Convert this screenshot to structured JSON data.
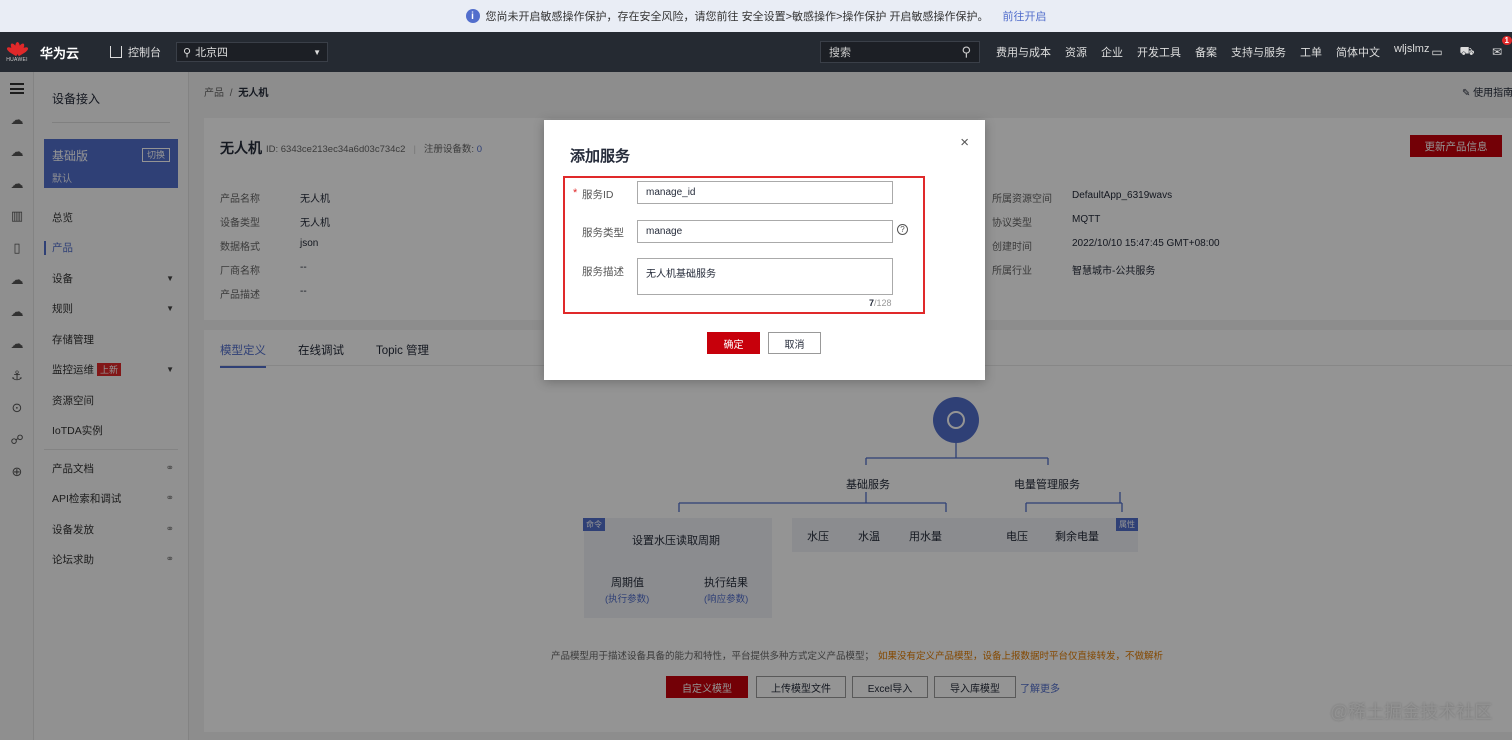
{
  "notice": {
    "text": "您尚未开启敏感操作保护，存在安全风险，请您前往 安全设置>敏感操作>操作保护 开启敏感操作保护。",
    "link": "前往开启"
  },
  "header": {
    "logo_caption": "HUAWEI",
    "brand": "华为云",
    "console": "控制台",
    "region": "北京四",
    "search_placeholder": "搜索",
    "nav": [
      "费用与成本",
      "资源",
      "企业",
      "开发工具",
      "备案",
      "支持与服务",
      "工单",
      "简体中文",
      "wljslmz"
    ],
    "badge": "1"
  },
  "sidebar": {
    "title": "设备接入",
    "edition": {
      "name": "基础版",
      "switch": "切换",
      "sub": "默认"
    },
    "items": [
      {
        "label": "总览"
      },
      {
        "label": "产品"
      },
      {
        "label": "设备"
      },
      {
        "label": "规则"
      },
      {
        "label": "存储管理"
      },
      {
        "label": "监控运维",
        "badge": "上新"
      },
      {
        "label": "资源空间"
      },
      {
        "label": "IoTDA实例"
      },
      {
        "label": "产品文档"
      },
      {
        "label": "API检索和调试"
      },
      {
        "label": "设备发放"
      },
      {
        "label": "论坛求助"
      }
    ]
  },
  "breadcrumb": {
    "parent": "产品",
    "sep": "/",
    "current": "无人机"
  },
  "guide": "使用指南",
  "product": {
    "name": "无人机",
    "id_label": "ID: 6343ce213ec34a6d03c734c2",
    "devices_label": "注册设备数:",
    "devices_count": "0",
    "update_button": "更新产品信息",
    "left": [
      {
        "k": "产品名称",
        "v": "无人机"
      },
      {
        "k": "设备类型",
        "v": "无人机"
      },
      {
        "k": "数据格式",
        "v": "json"
      },
      {
        "k": "厂商名称",
        "v": "--"
      },
      {
        "k": "产品描述",
        "v": "--"
      }
    ],
    "right": [
      {
        "k": "所属资源空间",
        "v": "DefaultApp_6319wavs"
      },
      {
        "k": "协议类型",
        "v": "MQTT"
      },
      {
        "k": "创建时间",
        "v": "2022/10/10 15:47:45 GMT+08:00"
      },
      {
        "k": "所属行业",
        "v": "智慧城市-公共服务"
      }
    ]
  },
  "tabs": [
    "模型定义",
    "在线调试",
    "Topic 管理"
  ],
  "diagram": {
    "service1": "基础服务",
    "service2": "电量管理服务",
    "command_tag": "命令",
    "property_tag": "属性",
    "command": "设置水压读取周期",
    "param1": "周期值",
    "param1_sub": "(执行参数)",
    "param2": "执行结果",
    "param2_sub": "(响应参数)",
    "props": [
      "水压",
      "水温",
      "用水量",
      "电压",
      "剩余电量"
    ]
  },
  "model_hint": {
    "text": "产品模型用于描述设备具备的能力和特性，平台提供多种方式定义产品模型；",
    "warning": "如果没有定义产品模型，设备上报数据时平台仅直接转发，不做解析"
  },
  "model_buttons": [
    "自定义模型",
    "上传模型文件",
    "Excel导入",
    "导入库模型"
  ],
  "learn_more": "了解更多",
  "watermark": "@稀土掘金技术社区",
  "modal": {
    "title": "添加服务",
    "close": "×",
    "required_mark": "*",
    "fields": [
      {
        "label": "服务ID",
        "value": "manage_id"
      },
      {
        "label": "服务类型",
        "value": "manage"
      },
      {
        "label": "服务描述",
        "value": "无人机基础服务"
      }
    ],
    "counter_current": "7",
    "counter_max": "/128",
    "ok": "确定",
    "cancel": "取消"
  }
}
